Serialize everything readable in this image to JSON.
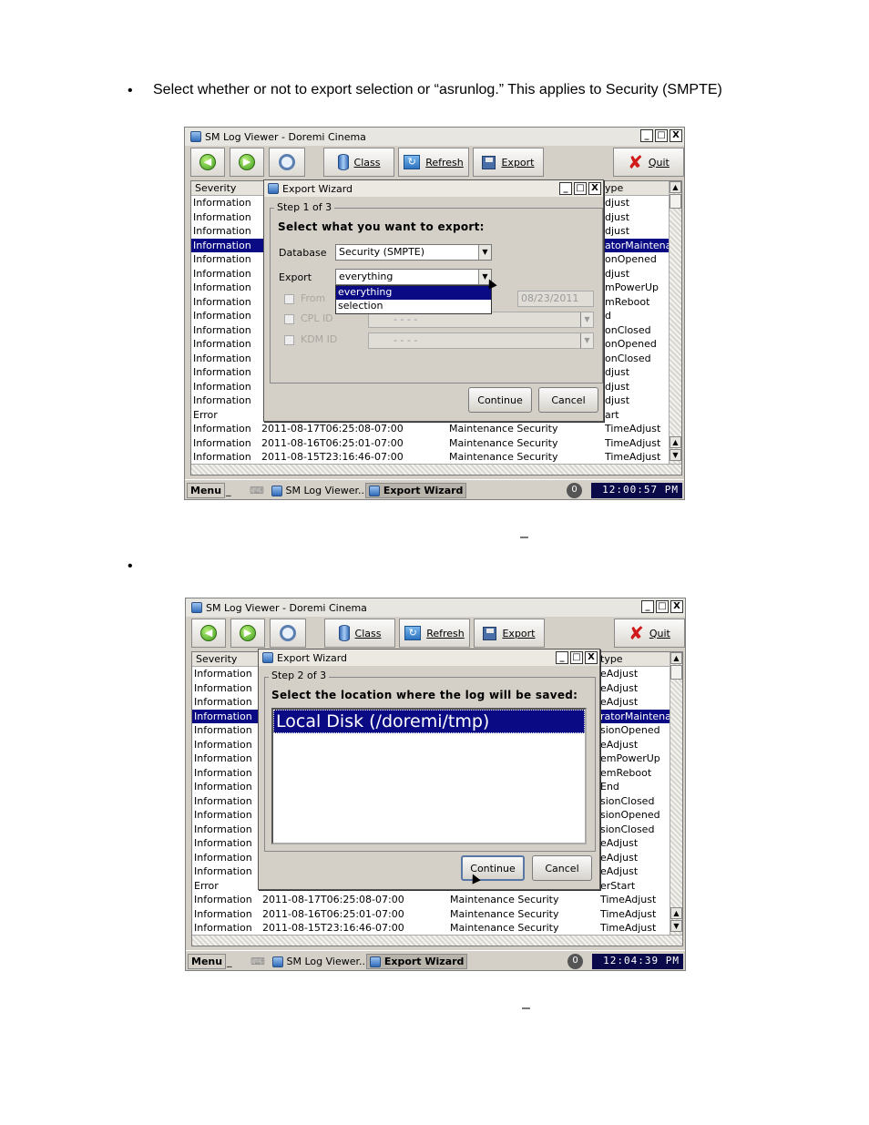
{
  "intro_text": "Select whether or not to export selection or “asrunlog.” This applies to Security (SMPTE)",
  "bullet_glyph": "•",
  "dash_glyph": "–",
  "app": {
    "title": "SM Log Viewer - Doremi Cinema",
    "toolbar": {
      "class_label": "Class",
      "refresh_label": "Refresh",
      "export_label": "Export",
      "quit_label": "Quit"
    },
    "window_buttons": {
      "minimize": "_",
      "maximize": "□",
      "close": "X"
    },
    "column_severity": "Severity",
    "taskbar": {
      "menu": "Menu",
      "min": "_",
      "viewer": "SM Log Viewer...",
      "wizard": "Export Wizard",
      "tray": "0"
    }
  },
  "shot1": {
    "type_header": "ype",
    "rows": [
      {
        "severity": "Information",
        "type": "djust"
      },
      {
        "severity": "Information",
        "type": "djust"
      },
      {
        "severity": "Information",
        "type": "djust"
      },
      {
        "severity": "Information",
        "type": "atorMaintena",
        "selected": true
      },
      {
        "severity": "Information",
        "type": "onOpened"
      },
      {
        "severity": "Information",
        "type": "djust"
      },
      {
        "severity": "Information",
        "type": "mPowerUp"
      },
      {
        "severity": "Information",
        "type": "mReboot"
      },
      {
        "severity": "Information",
        "type": "d"
      },
      {
        "severity": "Information",
        "type": "onClosed"
      },
      {
        "severity": "Information",
        "type": "onOpened"
      },
      {
        "severity": "Information",
        "type": "onClosed"
      },
      {
        "severity": "Information",
        "type": "djust"
      },
      {
        "severity": "Information",
        "type": "djust"
      },
      {
        "severity": "Information",
        "type": "djust"
      },
      {
        "severity": "Error",
        "type": "art"
      },
      {
        "severity": "Information",
        "date": "2011-08-17T06:25:08-07:00",
        "cls": "Maintenance Security",
        "type": "TimeAdjust"
      },
      {
        "severity": "Information",
        "date": "2011-08-16T06:25:01-07:00",
        "cls": "Maintenance Security",
        "type": "TimeAdjust"
      },
      {
        "severity": "Information",
        "date": "2011-08-15T23:16:46-07:00",
        "cls": "Maintenance Security",
        "type": "TimeAdjust"
      }
    ],
    "clock": "12:00:57 PM",
    "dialog": {
      "title": "Export Wizard",
      "step": "Step 1 of 3",
      "prompt": "Select what you want to export:",
      "database_label": "Database",
      "database_value": "Security (SMPTE)",
      "export_label": "Export",
      "export_value": "everything",
      "dropdown_options": [
        "everything",
        "selection"
      ],
      "from_label": "From",
      "from_date": "08/23/2011",
      "cpl_label": "CPL ID",
      "kdm_label": "KDM ID",
      "empty_combo": "-  -  -  -",
      "continue_label": "Continue",
      "cancel_label": "Cancel"
    }
  },
  "shot2": {
    "type_header": "type",
    "rows": [
      {
        "severity": "Information",
        "type": "eAdjust"
      },
      {
        "severity": "Information",
        "type": "eAdjust"
      },
      {
        "severity": "Information",
        "type": "eAdjust"
      },
      {
        "severity": "Information",
        "type": "ratorMaintena",
        "selected": true
      },
      {
        "severity": "Information",
        "type": "sionOpened"
      },
      {
        "severity": "Information",
        "type": "eAdjust"
      },
      {
        "severity": "Information",
        "type": "emPowerUp"
      },
      {
        "severity": "Information",
        "type": "emReboot"
      },
      {
        "severity": "Information",
        "type": "End"
      },
      {
        "severity": "Information",
        "type": "sionClosed"
      },
      {
        "severity": "Information",
        "type": "sionOpened"
      },
      {
        "severity": "Information",
        "type": "sionClosed"
      },
      {
        "severity": "Information",
        "type": "eAdjust"
      },
      {
        "severity": "Information",
        "type": "eAdjust"
      },
      {
        "severity": "Information",
        "type": "eAdjust"
      },
      {
        "severity": "Error",
        "type": "erStart"
      },
      {
        "severity": "Information",
        "date": "2011-08-17T06:25:08-07:00",
        "cls": "Maintenance Security",
        "type": "TimeAdjust"
      },
      {
        "severity": "Information",
        "date": "2011-08-16T06:25:01-07:00",
        "cls": "Maintenance Security",
        "type": "TimeAdjust"
      },
      {
        "severity": "Information",
        "date": "2011-08-15T23:16:46-07:00",
        "cls": "Maintenance Security",
        "type": "TimeAdjust"
      }
    ],
    "clock": "12:04:39 PM",
    "dialog": {
      "title": "Export Wizard",
      "step": "Step 2 of 3",
      "prompt": "Select the location where the log will be saved:",
      "location": "Local Disk (/doremi/tmp)",
      "continue_label": "Continue",
      "cancel_label": "Cancel"
    }
  }
}
